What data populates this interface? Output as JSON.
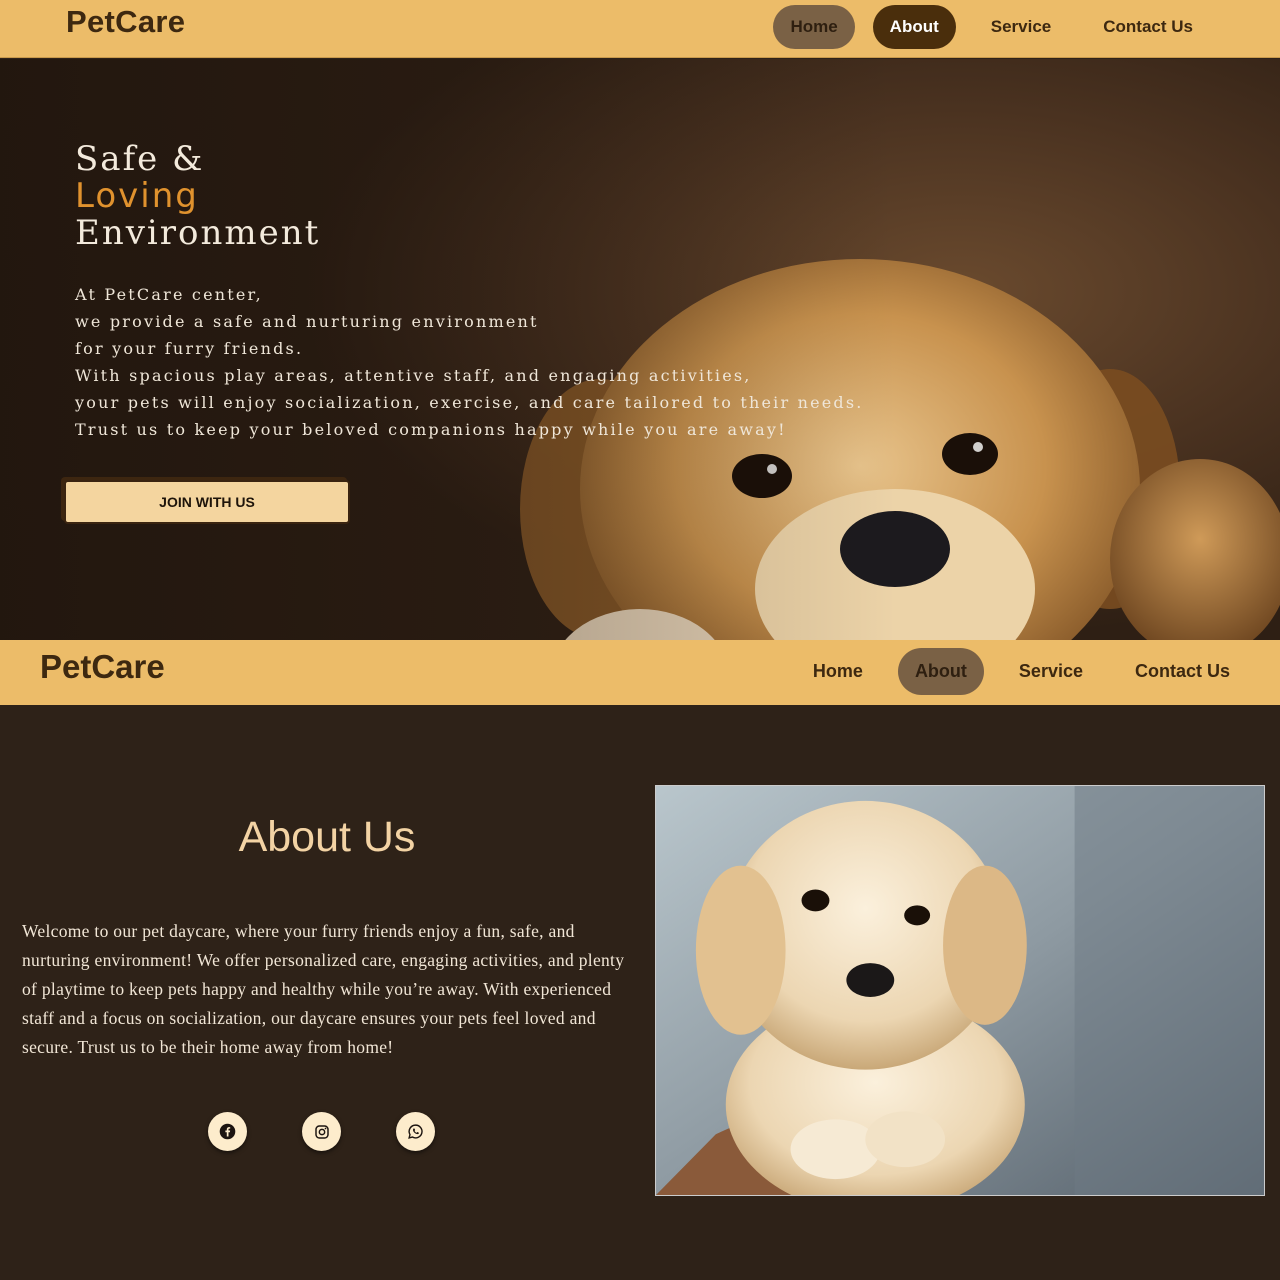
{
  "nav_top": {
    "logo": "PetCare",
    "items": [
      {
        "label": "Home",
        "state": "hover"
      },
      {
        "label": "About",
        "state": "active"
      },
      {
        "label": "Service",
        "state": "default"
      },
      {
        "label": "Contact Us",
        "state": "default"
      }
    ]
  },
  "hero": {
    "title_line1": "Safe &",
    "title_line2": "Loving",
    "title_line3": "Environment",
    "lines": [
      "At PetCare center,",
      "we provide a safe and nurturing environment",
      "for your furry friends.",
      "With spacious play areas, attentive staff, and engaging activities,",
      "your pets will enjoy socialization, exercise, and care tailored to their needs.",
      "Trust us to keep your beloved companions happy while you are away!"
    ],
    "button_label": "JOIN WITH US"
  },
  "nav_second": {
    "logo": "PetCare",
    "items": [
      {
        "label": "Home",
        "state": "default"
      },
      {
        "label": "About",
        "state": "active"
      },
      {
        "label": "Service",
        "state": "default"
      },
      {
        "label": "Contact Us",
        "state": "default"
      }
    ]
  },
  "about": {
    "heading": "About Us",
    "paragraph": "Welcome to our pet daycare, where your furry friends enjoy a fun, safe, and nurturing environment! We offer personalized care, engaging activities, and plenty of playtime to keep pets happy and healthy while you’re away. With experienced staff and a focus on socialization, our daycare ensures your pets feel loved and secure. Trust us to be their home away from home!",
    "social_icons": [
      "facebook-icon",
      "instagram-icon",
      "whatsapp-icon"
    ]
  },
  "colors": {
    "navbar": "#ecbc69",
    "accent": "#e0922e",
    "background": "#2e2218",
    "active_pill": "#4a2e0c",
    "hover_pill": "#7a6145",
    "button": "#f4d59f"
  }
}
